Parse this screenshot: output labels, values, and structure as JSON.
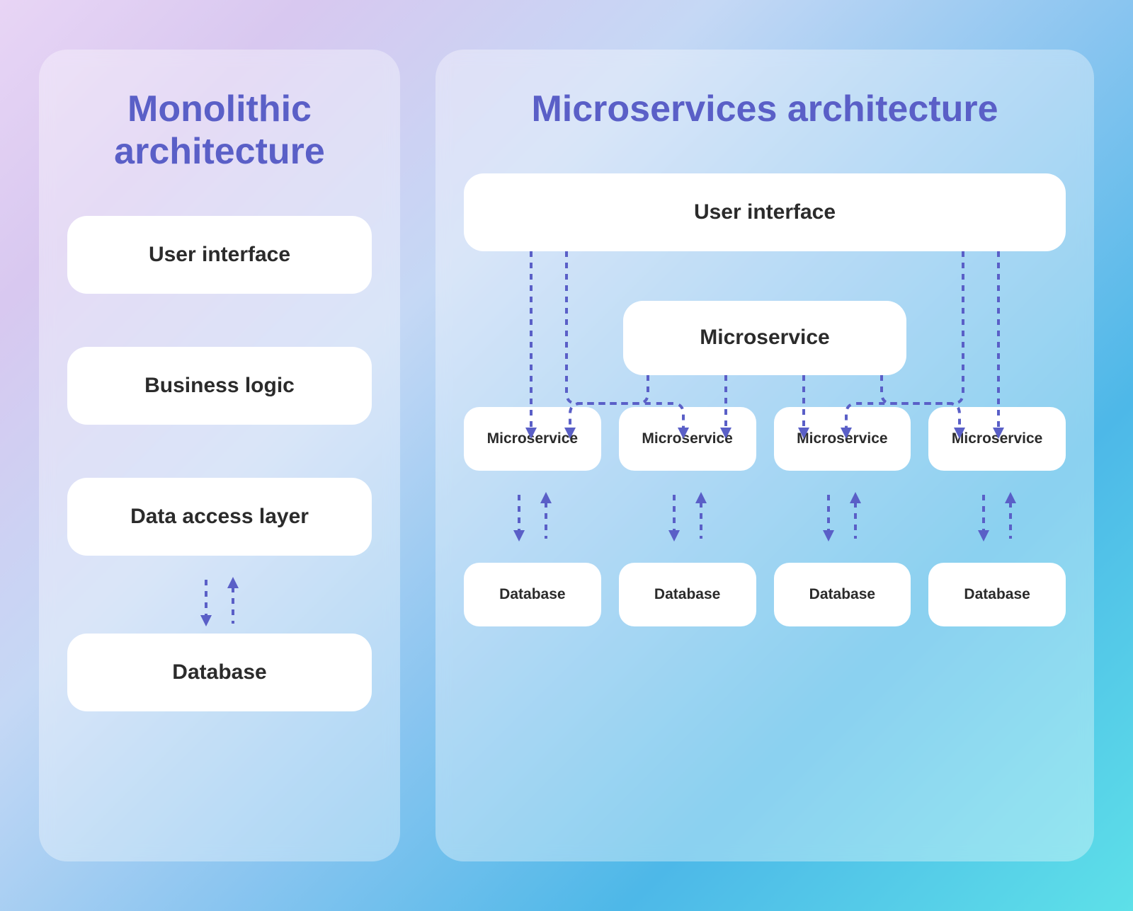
{
  "monolithic": {
    "title": "Monolithic architecture",
    "layers": {
      "ui": "User interface",
      "logic": "Business logic",
      "data": "Data access layer",
      "db": "Database"
    }
  },
  "microservices": {
    "title": "Microservices architecture",
    "ui": "User interface",
    "middle": "Microservice",
    "services": [
      "Microservice",
      "Microservice",
      "Microservice",
      "Microservice"
    ],
    "databases": [
      "Database",
      "Database",
      "Database",
      "Database"
    ]
  },
  "colors": {
    "accent": "#5a5fc7",
    "box": "#ffffff",
    "text": "#2b2b2b"
  }
}
